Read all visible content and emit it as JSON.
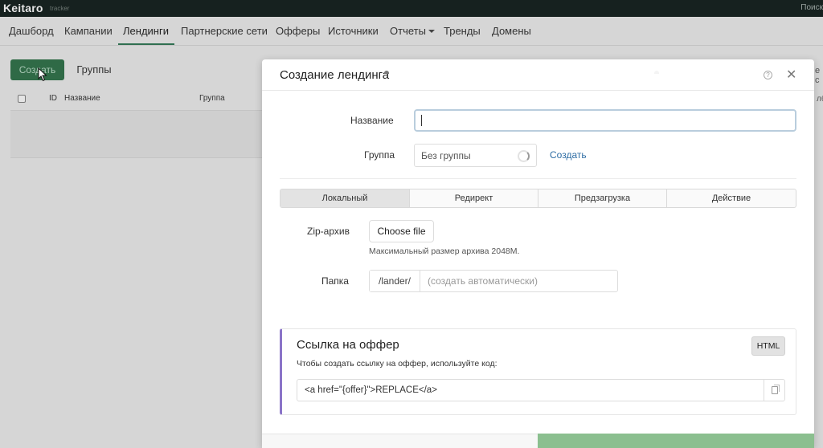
{
  "app": {
    "logo": "Keitaro",
    "logo_sub": "tracker",
    "search": "Поиск"
  },
  "nav": {
    "items": [
      {
        "label": "Дашборд"
      },
      {
        "label": "Кампании"
      },
      {
        "label": "Лендинги"
      },
      {
        "label": "Партнерские сети"
      },
      {
        "label": "Офферы"
      },
      {
        "label": "Источники"
      },
      {
        "label": "Отчеты"
      },
      {
        "label": "Тренды"
      },
      {
        "label": "Домены"
      }
    ],
    "active": "Лендинги"
  },
  "page": {
    "create_label": "Создать",
    "groups_label": "Группы",
    "columns": [
      "ID",
      "Название",
      "Группа"
    ],
    "right_peek_1": "е с",
    "right_peek_2": "лбе"
  },
  "modal": {
    "title": "Создание лендинга",
    "name_label": "Название",
    "name_value": "",
    "group_label": "Группа",
    "group_value": "Без группы",
    "group_create": "Создать",
    "tabs": [
      {
        "label": "Локальный"
      },
      {
        "label": "Редирект"
      },
      {
        "label": "Предзагрузка"
      },
      {
        "label": "Действие"
      }
    ],
    "active_tab": "Локальный",
    "zip_label": "Zip-архив",
    "choose_file": "Choose file",
    "zip_hint": "Максимальный размер архива 2048M.",
    "folder_label": "Папка",
    "folder_prefix": "/lander/",
    "folder_placeholder": "(создать автоматически)",
    "offer": {
      "title": "Ссылка на оффер",
      "badge": "HTML",
      "description": "Чтобы создать ссылку на оффер, используйте код:",
      "code": "<a href=\"{offer}\">REPLACE</a>"
    }
  },
  "colors": {
    "accent": "#2f6a46",
    "link": "#2e6da4",
    "offer_border": "#8a74c8",
    "save_green": "#8bbf8f"
  }
}
